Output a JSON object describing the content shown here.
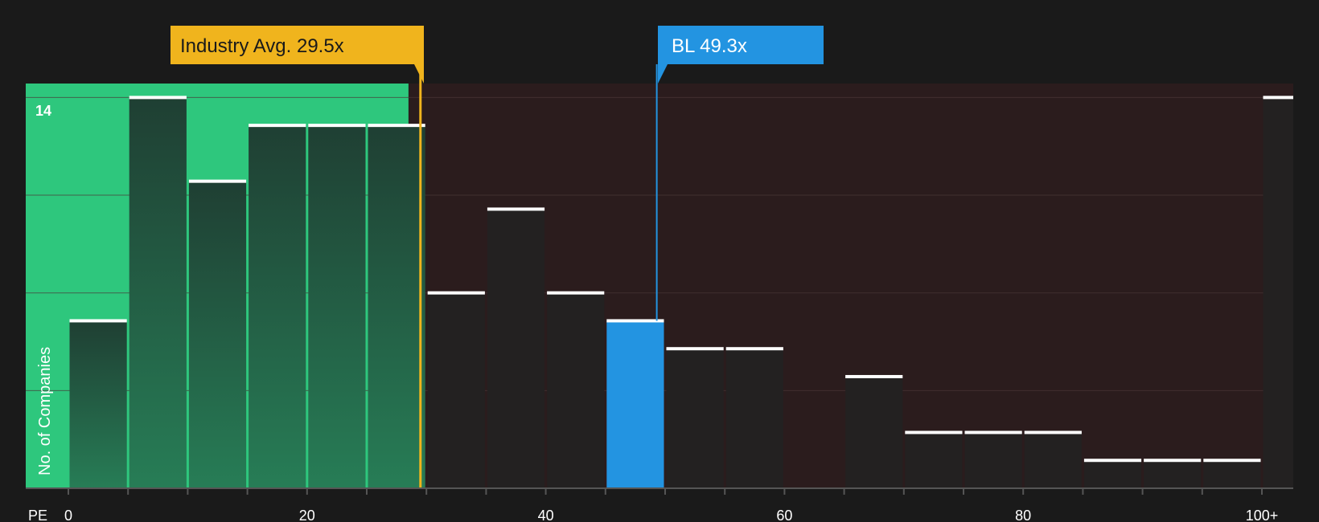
{
  "chart_data": {
    "type": "bar",
    "xlabel": "PE",
    "ylabel": "No. of Companies",
    "ylim": [
      0,
      14.5
    ],
    "yticks_labeled": [
      14
    ],
    "grid_y": [
      3.5,
      7,
      10.5,
      14
    ],
    "x_tick_values": [
      0,
      20,
      40,
      60,
      80,
      100
    ],
    "x_tick_labels": [
      "0",
      "20",
      "40",
      "60",
      "80",
      "100+"
    ],
    "bin_width": 5,
    "bins": [
      {
        "x0": 0,
        "x1": 5,
        "count": 6
      },
      {
        "x0": 5,
        "x1": 10,
        "count": 14
      },
      {
        "x0": 10,
        "x1": 15,
        "count": 11
      },
      {
        "x0": 15,
        "x1": 20,
        "count": 13
      },
      {
        "x0": 20,
        "x1": 25,
        "count": 13
      },
      {
        "x0": 25,
        "x1": 30,
        "count": 13
      },
      {
        "x0": 30,
        "x1": 35,
        "count": 7
      },
      {
        "x0": 35,
        "x1": 40,
        "count": 10
      },
      {
        "x0": 40,
        "x1": 45,
        "count": 7
      },
      {
        "x0": 45,
        "x1": 50,
        "count": 6,
        "highlight": true
      },
      {
        "x0": 50,
        "x1": 55,
        "count": 5
      },
      {
        "x0": 55,
        "x1": 60,
        "count": 5
      },
      {
        "x0": 65,
        "x1": 70,
        "count": 4
      },
      {
        "x0": 70,
        "x1": 75,
        "count": 2
      },
      {
        "x0": 75,
        "x1": 80,
        "count": 2
      },
      {
        "x0": 80,
        "x1": 85,
        "count": 2
      },
      {
        "x0": 85,
        "x1": 90,
        "count": 1
      },
      {
        "x0": 90,
        "x1": 95,
        "count": 1
      },
      {
        "x0": 95,
        "x1": 100,
        "count": 1
      },
      {
        "x0": 100,
        "x1": 102.5,
        "count": 14,
        "overflow": true
      }
    ],
    "industry_avg": {
      "value": 29.5,
      "label": "Industry Avg. 29.5x"
    },
    "company": {
      "value": 49.3,
      "label": "BL 49.3x"
    },
    "fair_range_max": 28.5,
    "colors": {
      "background": "#1a1a1a",
      "green_region": "#2ec77d",
      "green_bar_top": "#1f3f33",
      "green_bar_bottom": "#277d56",
      "red_region": "#2b1c1d",
      "dark_bar": "#232121",
      "highlight_bar": "#2394e1",
      "avg_callout": "#f0b41d",
      "company_callout": "#2394e1",
      "cap_line": "#ffffff",
      "grid": "#4a3838"
    }
  }
}
